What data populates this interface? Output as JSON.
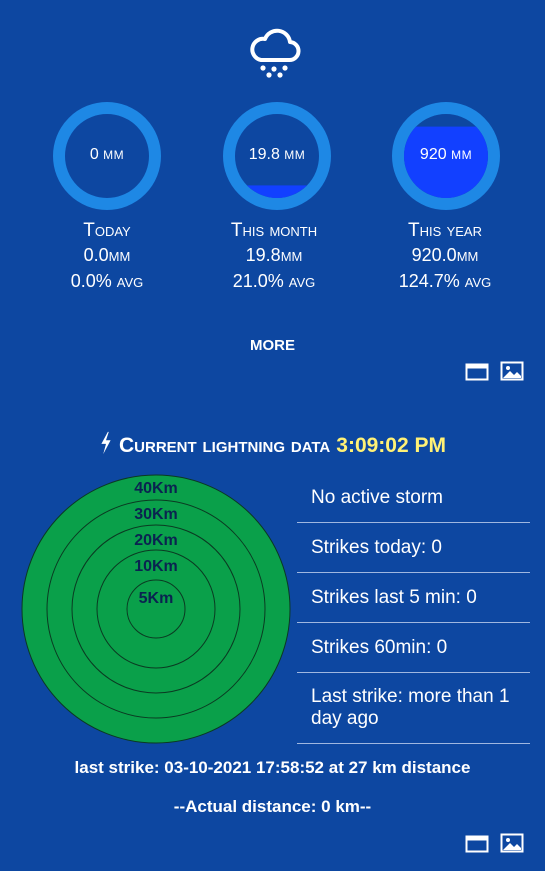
{
  "rain": {
    "icon": "cloud-rain-icon",
    "gauges": [
      {
        "value": "0",
        "unit": "mm",
        "fill": 0.0
      },
      {
        "value": "19.8",
        "unit": "mm",
        "fill": 0.15
      },
      {
        "value": "920",
        "unit": "mm",
        "fill": 0.85
      }
    ],
    "stats": [
      {
        "title": "Today",
        "amount": "0.0",
        "amount_unit": "mm",
        "avg": "0.0%",
        "avg_label": "avg"
      },
      {
        "title": "This month",
        "amount": "19.8",
        "amount_unit": "mm",
        "avg": "21.0%",
        "avg_label": "avg"
      },
      {
        "title": "This year",
        "amount": "920.0",
        "amount_unit": "mm",
        "avg": "124.7%",
        "avg_label": "avg"
      }
    ],
    "more_label": "MORE",
    "toolbar_icons": [
      "window-icon",
      "image-icon"
    ]
  },
  "lightning": {
    "title": "Current lightning data",
    "time": "3:09:02 PM",
    "radar_rings": [
      "40Km",
      "30Km",
      "20Km",
      "10Km",
      "5Km"
    ],
    "info": [
      "No active storm",
      "Strikes today: 0",
      "Strikes last 5 min: 0",
      "Strikes 60min: 0",
      "Last strike: more than 1 day ago"
    ],
    "last_strike": "last strike: 03-10-2021 17:58:52 at 27 km distance",
    "actual_distance": "--Actual distance: 0 km--",
    "toolbar_icons": [
      "window-icon",
      "image-icon"
    ]
  },
  "colors": {
    "background": "#0d47a1",
    "gauge_ring": "#1e88e5",
    "gauge_fill": "#1240ff",
    "radar_green": "#0aa04a",
    "time_yellow": "#fff176"
  }
}
